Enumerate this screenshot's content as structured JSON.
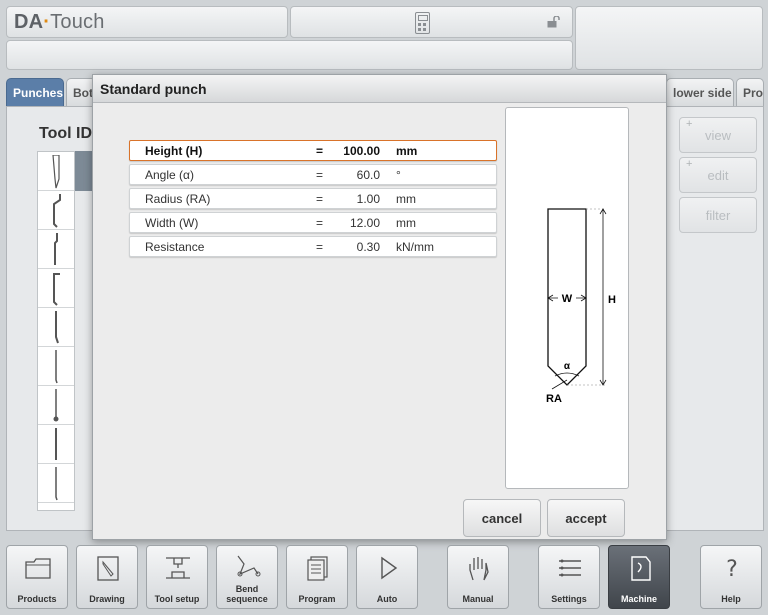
{
  "header": {
    "logo_text": "DA",
    "logo_suffix": "Touch"
  },
  "tabs": [
    {
      "label": "Punches",
      "active": true
    },
    {
      "label": "Bot"
    },
    {
      "label": "lower side"
    },
    {
      "label": "Pro"
    }
  ],
  "tool_list": {
    "header": "Tool ID"
  },
  "side_buttons": {
    "view": "view",
    "edit": "edit",
    "filter": "filter",
    "plus": "+"
  },
  "dialog": {
    "title": "Standard punch",
    "params": [
      {
        "label": "Height (H)",
        "eq": "=",
        "value": "100.00",
        "unit": "mm"
      },
      {
        "label": "Angle (α)",
        "eq": "=",
        "value": "60.0",
        "unit": "°"
      },
      {
        "label": "Radius (RA)",
        "eq": "=",
        "value": "1.00",
        "unit": "mm"
      },
      {
        "label": "Width (W)",
        "eq": "=",
        "value": "12.00",
        "unit": "mm"
      },
      {
        "label": "Resistance",
        "eq": "=",
        "value": "0.30",
        "unit": "kN/mm"
      }
    ],
    "drawing_labels": {
      "width": "W",
      "height": "H",
      "angle": "α",
      "radius": "RA"
    },
    "cancel_label": "cancel",
    "accept_label": "accept"
  },
  "bottom_nav": [
    {
      "label": "Products",
      "icon": "folder-icon"
    },
    {
      "label": "Drawing",
      "icon": "drawing-icon"
    },
    {
      "label": "Tool setup",
      "icon": "tool-setup-icon"
    },
    {
      "label": "Bend sequence",
      "icon": "bend-sequence-icon"
    },
    {
      "label": "Program",
      "icon": "program-icon"
    },
    {
      "label": "Auto",
      "icon": "play-icon"
    },
    {
      "label": "Manual",
      "icon": "hand-icon"
    },
    {
      "label": "Settings",
      "icon": "settings-icon"
    },
    {
      "label": "Machine",
      "icon": "machine-icon",
      "active": true
    },
    {
      "label": "Help",
      "icon": "help-icon"
    }
  ]
}
